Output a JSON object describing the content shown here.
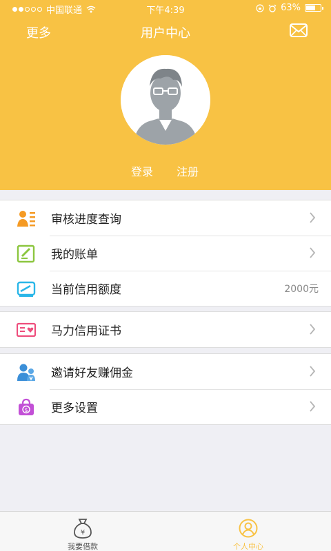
{
  "status_bar": {
    "carrier": "中国联通",
    "time": "下午4:39",
    "battery": "63%",
    "battery_level": 0.63,
    "signal_bars_filled": 2,
    "signal_bars_total": 5,
    "icons": [
      "wifi-icon",
      "lock-rotation-icon",
      "alarm-icon",
      "battery-icon"
    ]
  },
  "nav": {
    "left": "更多",
    "title": "用户中心",
    "right_icon": "mail-icon"
  },
  "profile": {
    "login": "登录",
    "register": "注册"
  },
  "menu_groups": [
    [
      {
        "label": "审核进度查询",
        "icon": "review-progress-icon",
        "icon_color": "#f59a23"
      },
      {
        "label": "我的账单",
        "icon": "bill-icon",
        "icon_color": "#8cc63f"
      },
      {
        "label": "当前信用额度",
        "icon": "credit-limit-icon",
        "icon_color": "#29b6e8",
        "value": "2000元"
      }
    ],
    [
      {
        "label": "马力信用证书",
        "icon": "credit-certificate-icon",
        "icon_color": "#ee4d7c"
      }
    ],
    [
      {
        "label": "邀请好友赚佣金",
        "icon": "invite-friends-icon",
        "icon_color": "#3b8fd8"
      },
      {
        "label": "更多设置",
        "icon": "settings-bag-icon",
        "icon_color": "#c24fd6"
      }
    ]
  ],
  "tabbar": {
    "tabs": [
      {
        "label": "我要借款",
        "icon": "money-bag-icon",
        "active": false
      },
      {
        "label": "个人中心",
        "icon": "user-circle-icon",
        "active": true
      }
    ]
  },
  "colors": {
    "primary": "#f8c244",
    "tab_active": "#f8c244",
    "tab_inactive": "#555555",
    "background": "#efeff4"
  }
}
